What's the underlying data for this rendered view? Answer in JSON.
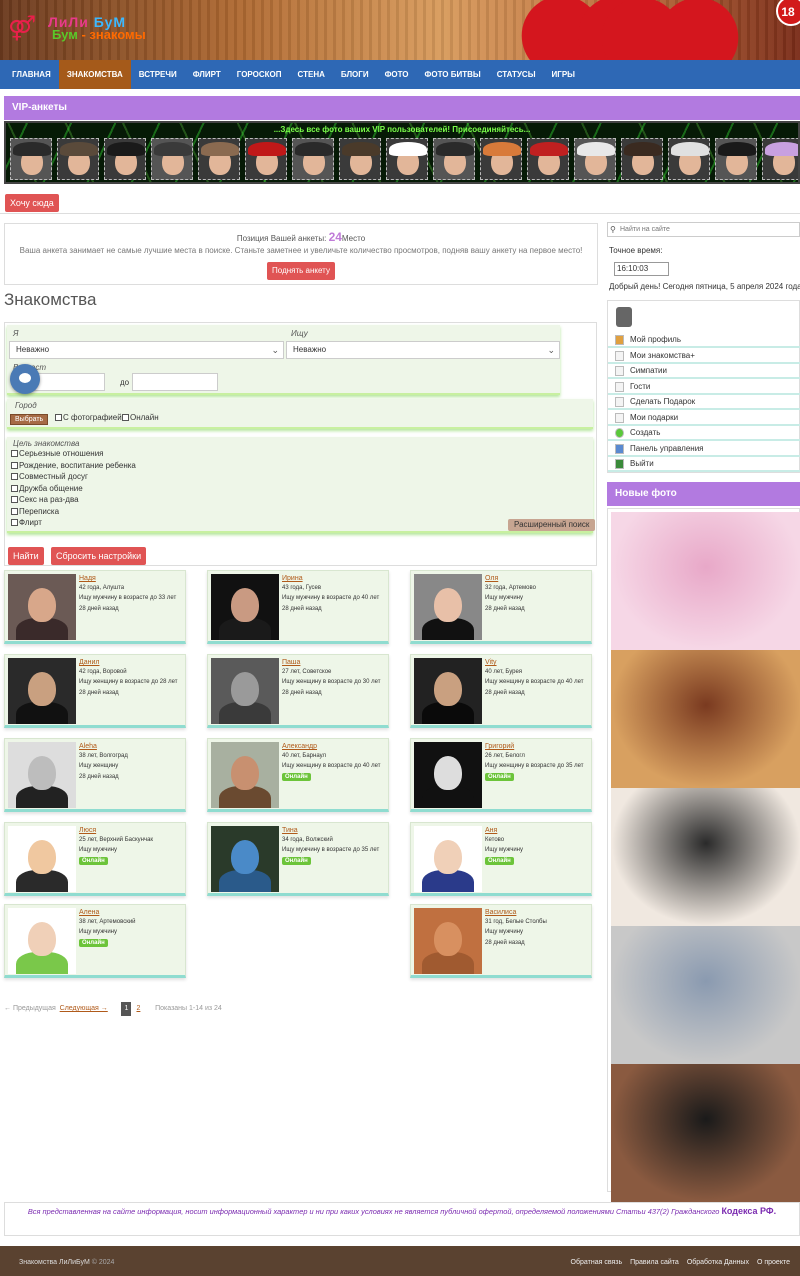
{
  "header": {
    "logo_symbol": "⚤",
    "logo_line1_a": "ЛиЛи",
    "logo_line1_b": "БуМ",
    "logo_line2_a": "Бум",
    "logo_line2_b": " - знакомы",
    "age_badge": "18"
  },
  "nav": [
    {
      "label": "Главная",
      "active": false
    },
    {
      "label": "Знакомства",
      "active": true
    },
    {
      "label": "Встречи",
      "active": false
    },
    {
      "label": "Флирт",
      "active": false
    },
    {
      "label": "Гороскоп",
      "active": false
    },
    {
      "label": "Стена",
      "active": false
    },
    {
      "label": "Блоги",
      "active": false
    },
    {
      "label": "Фото",
      "active": false
    },
    {
      "label": "Фото битвы",
      "active": false
    },
    {
      "label": "Статусы",
      "active": false
    },
    {
      "label": "Игры",
      "active": false
    }
  ],
  "vip": {
    "title": "VIP-анкеты",
    "marquee": "...Здесь все фото ваших VIP пользователей! Присоединяйтесь...",
    "want_here": "Хочу сюда"
  },
  "position": {
    "prefix": "Позиция Вашей анкеты:",
    "number": "24",
    "suffix": "Место",
    "message": "Ваша анкета занимает не самые лучшие места в поиске. Станьте заметнее и увеличьте количество просмотров, подняв вашу анкету на первое место!",
    "raise_button": "Поднять анкету"
  },
  "page_title": "Знакомства",
  "filter": {
    "i_label": "Я",
    "i_value": "Неважно",
    "seek_label": "Ищу",
    "seek_value": "Неважно",
    "age_label": "Возраст",
    "age_to": "до",
    "city_label": "Город",
    "choose_button": "Выбрать",
    "with_photo": "С фотографией",
    "online": "Онлайн",
    "goal_label": "Цель знакомства",
    "goals": [
      "Серьезные отношения",
      "Рождение, воспитание ребенка",
      "Совместный досуг",
      "Дружба общение",
      "Секс на раз-два",
      "Переписка",
      "Флирт"
    ],
    "advanced_button": "Расширенный поиск",
    "find_button": "Найти",
    "reset_button": "Сбросить настройки"
  },
  "users": [
    {
      "name": "Надя",
      "age": "42 года, Алушта",
      "looking": "Ищу мужчину в возрасте до 33 лет",
      "status": "28 дней назад",
      "online": false,
      "skin": "#d8a78a",
      "body": "#3a2a2a",
      "bg": "#6b5a55"
    },
    {
      "name": "Ирина",
      "age": "43 года, Гусев",
      "looking": "Ищу мужчину в возрасте до 40 лет",
      "status": "28 дней назад",
      "online": false,
      "skin": "#c99a82",
      "body": "#1a1a1a",
      "bg": "#111111"
    },
    {
      "name": "Оля",
      "age": "32 года, Артемово",
      "looking": "Ищу мужчину",
      "status": "28 дней назад",
      "online": false,
      "skin": "#e8c0a8",
      "body": "#111111",
      "bg": "#888888"
    },
    {
      "name": "Данил",
      "age": "42 года, Воровой",
      "looking": "Ищу женщину в возрасте до 28 лет",
      "status": "28 дней назад",
      "online": false,
      "skin": "#c9a080",
      "body": "#111111",
      "bg": "#2a2a2a"
    },
    {
      "name": "Паша",
      "age": "27 лет, Советское",
      "looking": "Ищу женщину в возрасте до 30 лет",
      "status": "28 дней назад",
      "online": false,
      "skin": "#9a9a9a",
      "body": "#3a3a3a",
      "bg": "#5a5a5a"
    },
    {
      "name": "Vity",
      "age": "40 лет, Бурея",
      "looking": "Ищу женщину в возрасте до 40 лет",
      "status": "28 дней назад",
      "online": false,
      "skin": "#c9a080",
      "body": "#0a0a0a",
      "bg": "#222222"
    },
    {
      "name": "Aleha",
      "age": "38 лет, Волгоград",
      "looking": "Ищу женщину",
      "status": "28 дней назад",
      "online": false,
      "skin": "#bdbdbd",
      "body": "#222222",
      "bg": "#dddddd"
    },
    {
      "name": "Александр",
      "age": "40 лет, Барнаул",
      "looking": "Ищу женщину в возрасте до 40 лет",
      "status": "Онлайн",
      "online": true,
      "skin": "#c89070",
      "body": "#6a4a30",
      "bg": "#a8b0a0"
    },
    {
      "name": "Григорий",
      "age": "26 лет, Белогл",
      "looking": "Ищу женщину в возрасте до 35 лет",
      "status": "Онлайн",
      "online": true,
      "skin": "#dddddd",
      "body": "#111111",
      "bg": "#111111"
    },
    {
      "name": "Люся",
      "age": "25 лет, Верхний Баскунчак",
      "looking": "Ищу мужчину",
      "status": "Онлайн",
      "online": true,
      "skin": "#f0c8a0",
      "body": "#2a2a2a",
      "bg": "#ffffff"
    },
    {
      "name": "Тина",
      "age": "34 года, Волжский",
      "looking": "Ищу мужчину в возрасте до 35 лет",
      "status": "Онлайн",
      "online": true,
      "skin": "#4a8ac8",
      "body": "#2a5a8a",
      "bg": "#2a3a2a"
    },
    {
      "name": "Аня",
      "age": "Кетово",
      "looking": "Ищу мужчину",
      "status": "Онлайн",
      "online": true,
      "skin": "#f0d0b8",
      "body": "#2a3a8a",
      "bg": "#ffffff"
    },
    {
      "name": "Алена",
      "age": "38 лет, Артемовский",
      "looking": "Ищу мужчину",
      "status": "Онлайн",
      "online": true,
      "skin": "#f0d0b8",
      "body": "#7ac84a",
      "bg": "#ffffff"
    },
    {
      "name": "Василиса",
      "age": "31 год, Белые Столбы",
      "looking": "Ищу мужчину",
      "status": "28 дней назад",
      "online": false,
      "skin": "#d89060",
      "body": "#a05a30",
      "bg": "#c07040"
    }
  ],
  "pager": {
    "prev": "← Предыдущая",
    "next": "Следующая →",
    "pages": [
      "1",
      "2"
    ],
    "current": "1",
    "shown": "Показаны 1-14 из 24"
  },
  "sidebar": {
    "search_placeholder": "Найти на сайте",
    "clock_label": "Точное время:",
    "clock_value": "16:10:03",
    "greeting": "Добрый день! Сегодня пятница, 5 апреля 2024 года.",
    "menu": [
      {
        "label": "Мой профиль",
        "icon": "home-icon"
      },
      {
        "label": "Мои знакомства+",
        "icon": "page-icon"
      },
      {
        "label": "Симпатии",
        "icon": "page-icon"
      },
      {
        "label": "Гости",
        "icon": "page-icon"
      },
      {
        "label": "Сделать Подарок",
        "icon": "page-icon"
      },
      {
        "label": "Мои подарки",
        "icon": "page-icon"
      },
      {
        "label": "Создать",
        "icon": "plus-icon"
      },
      {
        "label": "Панель управления",
        "icon": "panel-icon"
      },
      {
        "label": "Выйти",
        "icon": "exit-icon"
      }
    ],
    "new_photos_title": "Новые фото",
    "new_photos": [
      {
        "c1": "#f6d7e6",
        "c2": "#e8a8c8"
      },
      {
        "c1": "#d8a060",
        "c2": "#7a3a20"
      },
      {
        "c1": "#f0e8e0",
        "c2": "#2a2a2a"
      },
      {
        "c1": "#c8c8c8",
        "c2": "#8a9ab0"
      },
      {
        "c1": "#8a5a40",
        "c2": "#1a1a1a"
      }
    ]
  },
  "disclaimer": {
    "text": "Вся представленная на сайте информация,   носит информационный характер и ни при каких условиях не является публичной офертой,  определяемой положениями Статьи 437(2) Гражданского",
    "code": "Кодекса РФ."
  },
  "footer": {
    "copyright": "Знакомства ЛиЛиБуМ",
    "year": "© 2024",
    "links": [
      "Обратная связь",
      "Правила сайта",
      "Обработка Данных",
      "О проекте"
    ]
  },
  "colors": {
    "nav_bg": "#2e68b5",
    "nav_active": "#a55a1a",
    "accent_purple": "#b27ae0",
    "button_red": "#e05454",
    "online_green": "#6cc43a",
    "footer_bg": "#5a4230"
  }
}
